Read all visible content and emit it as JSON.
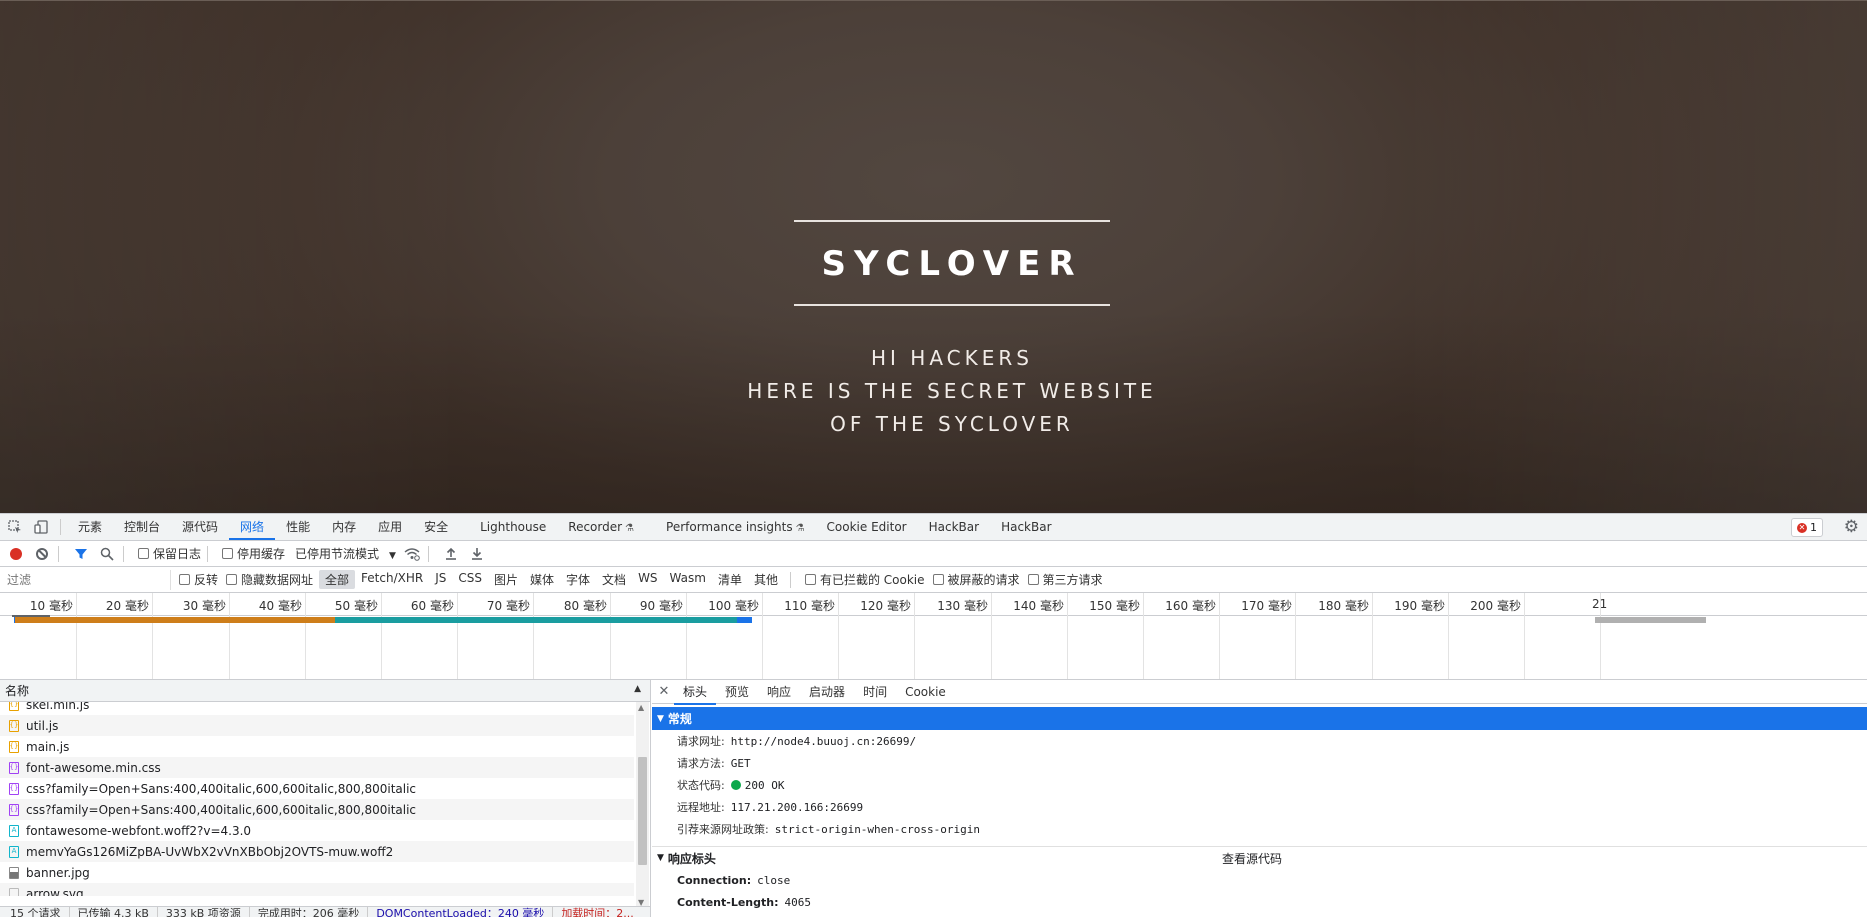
{
  "hero": {
    "title": "SYCLOVER",
    "lines": [
      "HI HACKERS",
      "HERE IS THE SECRET WEBSITE",
      "OF THE SYCLOVER"
    ]
  },
  "devtools": {
    "tabs": [
      {
        "label": "元素"
      },
      {
        "label": "控制台"
      },
      {
        "label": "源代码"
      },
      {
        "label": "网络",
        "active": true
      },
      {
        "label": "性能"
      },
      {
        "label": "内存"
      },
      {
        "label": "应用"
      },
      {
        "label": "安全"
      },
      {
        "label": "Lighthouse"
      },
      {
        "label": "Recorder",
        "icon": "beaker-icon"
      },
      {
        "label": "Performance insights",
        "icon": "beaker-icon"
      },
      {
        "label": "Cookie Editor"
      },
      {
        "label": "HackBar"
      },
      {
        "label": "HackBar"
      }
    ],
    "error_count": "1",
    "toolbar": {
      "preserve_log": "保留日志",
      "disable_cache": "停用缓存",
      "throttling": "已停用节流模式"
    },
    "filter": {
      "placeholder": "过滤",
      "invert": "反转",
      "hide_data_urls": "隐藏数据网址",
      "types": [
        "全部",
        "Fetch/XHR",
        "JS",
        "CSS",
        "图片",
        "媒体",
        "字体",
        "文档",
        "WS",
        "Wasm",
        "清单",
        "其他"
      ],
      "active_type": "全部",
      "blocked_cookies": "有已拦截的 Cookie",
      "blocked_requests": "被屏蔽的请求",
      "third_party": "第三方请求"
    },
    "timeline_ticks": [
      "10 毫秒",
      "20 毫秒",
      "30 毫秒",
      "40 毫秒",
      "50 毫秒",
      "60 毫秒",
      "70 毫秒",
      "80 毫秒",
      "90 毫秒",
      "100 毫秒",
      "110 毫秒",
      "120 毫秒",
      "130 毫秒",
      "140 毫秒",
      "150 毫秒",
      "160 毫秒",
      "170 毫秒",
      "180 毫秒",
      "190 毫秒",
      "200 毫秒",
      "21"
    ],
    "list": {
      "header": "名称",
      "rows": [
        {
          "name": "skel.min.js",
          "type": "js"
        },
        {
          "name": "util.js",
          "type": "js"
        },
        {
          "name": "main.js",
          "type": "js"
        },
        {
          "name": "font-awesome.min.css",
          "type": "css"
        },
        {
          "name": "css?family=Open+Sans:400,400italic,600,600italic,800,800italic",
          "type": "css"
        },
        {
          "name": "css?family=Open+Sans:400,400italic,600,600italic,800,800italic",
          "type": "css"
        },
        {
          "name": "fontawesome-webfont.woff2?v=4.3.0",
          "type": "font"
        },
        {
          "name": "memvYaGs126MiZpBA-UvWbX2vVnXBbObj2OVTS-muw.woff2",
          "type": "font"
        },
        {
          "name": "banner.jpg",
          "type": "img"
        },
        {
          "name": "arrow.svg",
          "type": "svg"
        }
      ],
      "status": [
        "15 个请求",
        "已传输 4.3 kB",
        "333 kB 项资源",
        "完成用时：206 毫秒",
        "DOMContentLoaded：240 毫秒",
        "加载时间：2..."
      ]
    },
    "detail": {
      "tabs": [
        "标头",
        "预览",
        "响应",
        "启动器",
        "时间",
        "Cookie"
      ],
      "active_tab": "标头",
      "general_title": "常规",
      "general": [
        {
          "key": "请求网址:",
          "value": "http://node4.buuoj.cn:26699/"
        },
        {
          "key": "请求方法:",
          "value": "GET"
        },
        {
          "key": "状态代码:",
          "value": "200 OK"
        },
        {
          "key": "远程地址:",
          "value": "117.21.200.166:26699"
        },
        {
          "key": "引荐来源网址政策:",
          "value": "strict-origin-when-cross-origin"
        }
      ],
      "response_title": "响应标头",
      "view_source": "查看源代码",
      "response_headers": [
        {
          "key": "Connection:",
          "value": "close"
        },
        {
          "key": "Content-Length:",
          "value": "4065"
        }
      ]
    }
  }
}
